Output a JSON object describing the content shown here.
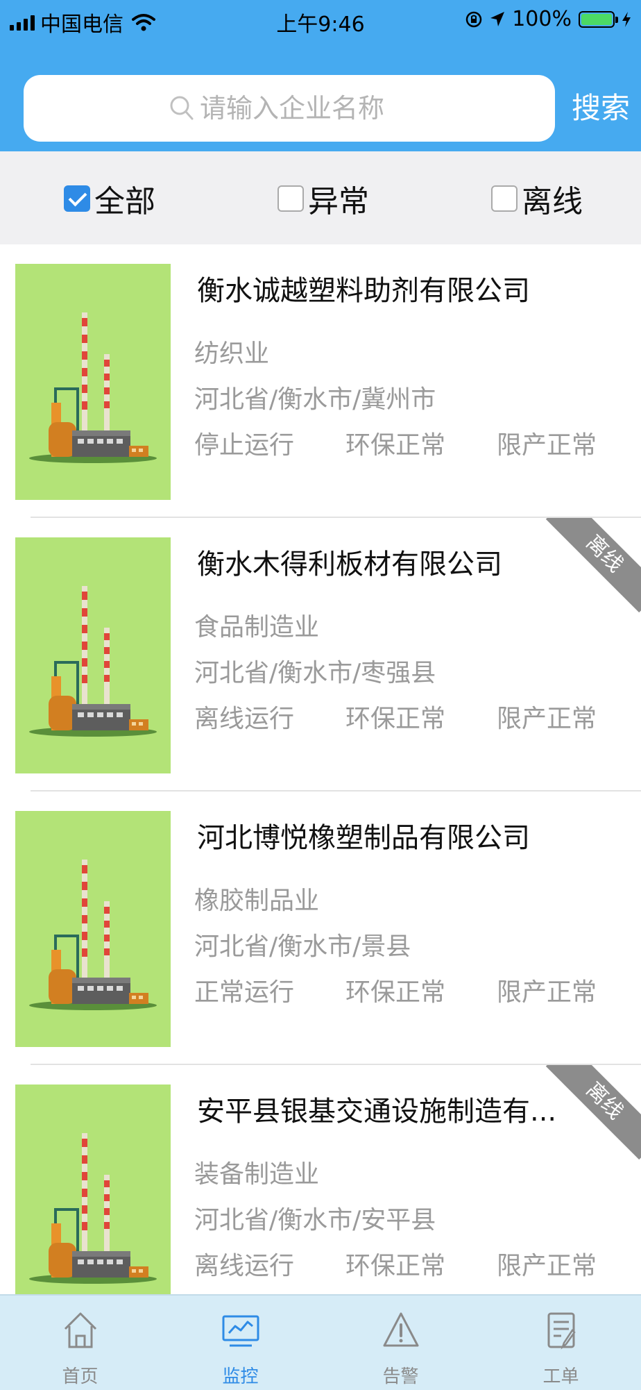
{
  "status_bar": {
    "carrier": "中国电信",
    "time": "上午9:46",
    "battery": "100%"
  },
  "search": {
    "placeholder": "请输入企业名称",
    "button_label": "搜索"
  },
  "filters": [
    {
      "label": "全部",
      "checked": true
    },
    {
      "label": "异常",
      "checked": false
    },
    {
      "label": "离线",
      "checked": false
    }
  ],
  "companies": [
    {
      "name": "衡水诚越塑料助剂有限公司",
      "industry": "纺织业",
      "region": "河北省/衡水市/冀州市",
      "run_status": "停止运行",
      "env_status": "环保正常",
      "limit_status": "限产正常",
      "badge": ""
    },
    {
      "name": "衡水木得利板材有限公司",
      "industry": "食品制造业",
      "region": "河北省/衡水市/枣强县",
      "run_status": "离线运行",
      "env_status": "环保正常",
      "limit_status": "限产正常",
      "badge": "离线"
    },
    {
      "name": "河北博悦橡塑制品有限公司",
      "industry": "橡胶制品业",
      "region": "河北省/衡水市/景县",
      "run_status": "正常运行",
      "env_status": "环保正常",
      "limit_status": "限产正常",
      "badge": ""
    },
    {
      "name": "安平县银基交通设施制造有...",
      "industry": "装备制造业",
      "region": "河北省/衡水市/安平县",
      "run_status": "离线运行",
      "env_status": "环保正常",
      "limit_status": "限产正常",
      "badge": "离线"
    }
  ],
  "tabs": [
    {
      "label": "首页",
      "icon": "home-icon",
      "active": false
    },
    {
      "label": "监控",
      "icon": "monitor-icon",
      "active": true
    },
    {
      "label": "告警",
      "icon": "alert-icon",
      "active": false
    },
    {
      "label": "工单",
      "icon": "work-order-icon",
      "active": false
    }
  ],
  "colors": {
    "header": "#46aaf0",
    "accent": "#2e8be6",
    "thumb_bg": "#b3e377",
    "badge": "#8c8c8c"
  }
}
